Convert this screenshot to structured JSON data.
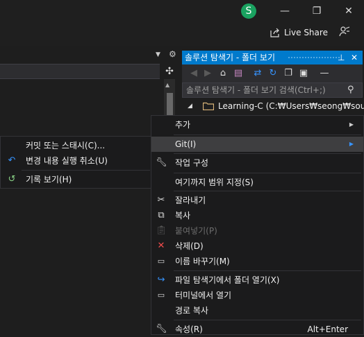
{
  "titlebar": {
    "avatar_letter": "S",
    "live_share_label": "Live Share",
    "minimize": "—",
    "restore": "❐",
    "close": "✕"
  },
  "solution_explorer": {
    "title": "솔루션 탐색기 - 폴더 보기",
    "pin": "⊥",
    "close": "✕",
    "search_placeholder": "솔루션 탐색기 - 폴더 보기 검색(Ctrl+;)",
    "tree_root": "Learning-C (C:₩Users₩seong₩source₩"
  },
  "context_menu": {
    "items": [
      {
        "label": "추가",
        "icon": "",
        "submenu": true
      },
      {
        "label": "Git(I)",
        "icon": "",
        "submenu": true,
        "highlighted": true
      },
      {
        "label": "작업 구성",
        "icon": "wrench-icon"
      },
      {
        "label": "여기까지 범위 지정(S)",
        "icon": ""
      },
      {
        "label": "잘라내기",
        "icon": "scissors-icon"
      },
      {
        "label": "복사",
        "icon": "copy-icon"
      },
      {
        "label": "붙여넣기(P)",
        "icon": "paste-icon",
        "disabled": true
      },
      {
        "label": "삭제(D)",
        "icon": "delete-icon"
      },
      {
        "label": "이름 바꾸기(M)",
        "icon": "rename-icon"
      },
      {
        "label": "파일 탐색기에서 폴더 열기(X)",
        "icon": "open-folder-icon"
      },
      {
        "label": "터미널에서 열기",
        "icon": "terminal-icon"
      },
      {
        "label": "경로 복사",
        "icon": ""
      },
      {
        "label": "속성(R)",
        "icon": "wrench-icon",
        "shortcut": "Alt+Enter"
      }
    ]
  },
  "git_submenu": {
    "items": [
      {
        "label": "커밋 또는 스태시(C)...",
        "icon": ""
      },
      {
        "label": "변경 내용 실행 취소(U)",
        "icon": "undo-icon"
      },
      {
        "label": "기록 보기(H)",
        "icon": "history-icon"
      }
    ]
  },
  "colors": {
    "accent": "#007acc",
    "background": "#1e1e1e",
    "menu_bg": "#1b1b1c",
    "highlight": "#3e3e40"
  }
}
